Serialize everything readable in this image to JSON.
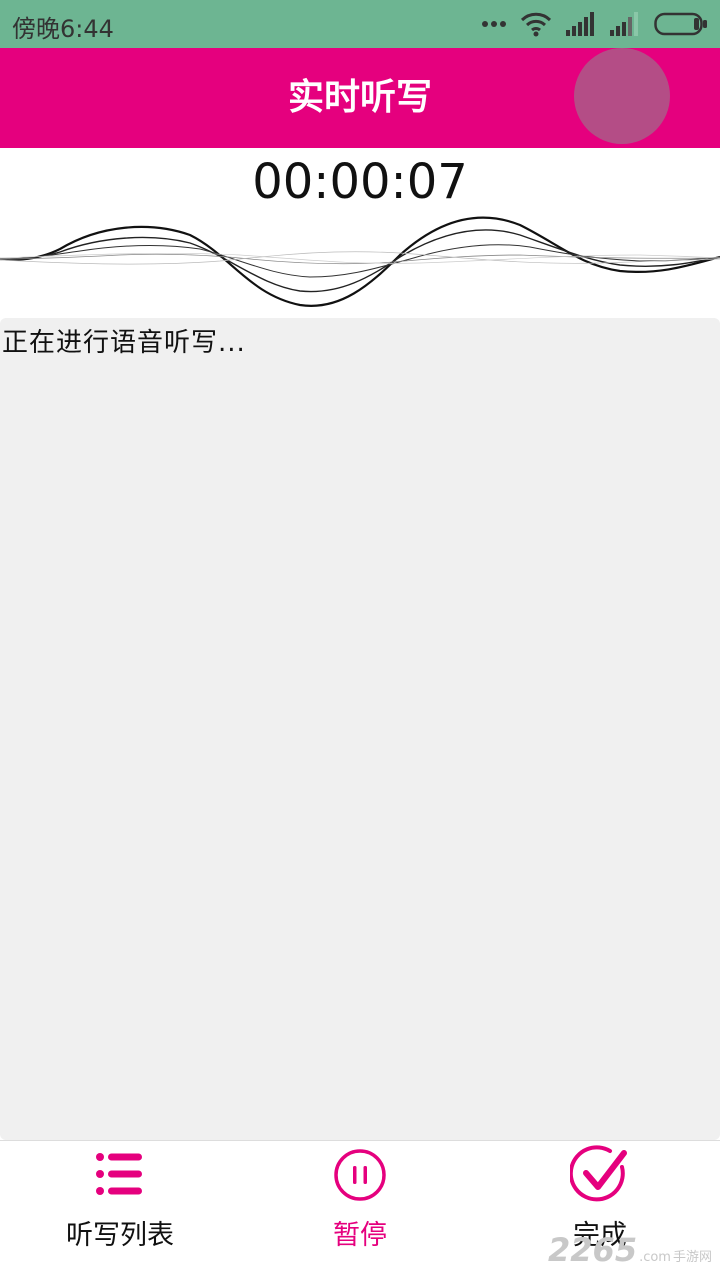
{
  "status_bar": {
    "time": "傍晚6:44",
    "icons": [
      "more-dots-icon",
      "wifi-icon",
      "signal-icon",
      "signal-icon-2",
      "battery-icon"
    ]
  },
  "header": {
    "title": "实时听写"
  },
  "recording": {
    "elapsed": "00:00:07"
  },
  "transcript": {
    "text": "正在进行语音听写..."
  },
  "bottom_nav": {
    "items": [
      {
        "label": "听写列表",
        "icon": "list-icon",
        "active": false
      },
      {
        "label": "暂停",
        "icon": "pause-icon",
        "active": true
      },
      {
        "label": "完成",
        "icon": "check-circle-icon",
        "active": false
      }
    ]
  },
  "watermark": {
    "main": "2265",
    "com": ".com",
    "sub": "手游网"
  },
  "colors": {
    "accent": "#e5007e",
    "status_bar": "#6db592",
    "panel": "#f0f0f0"
  }
}
